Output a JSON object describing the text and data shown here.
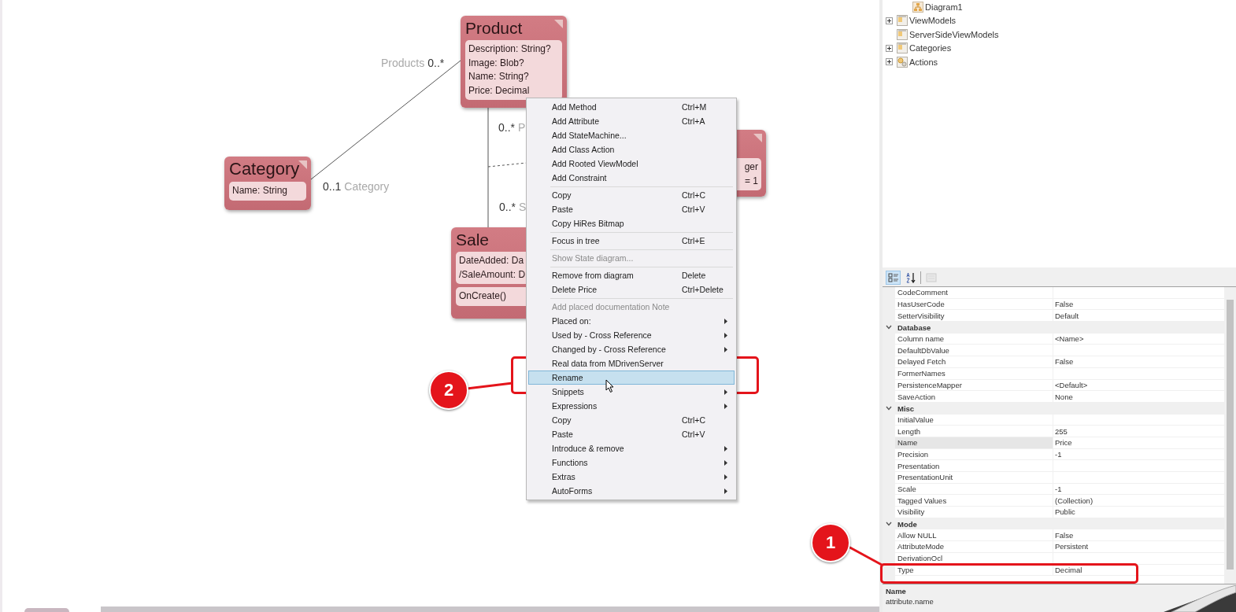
{
  "diagram": {
    "classes": [
      {
        "name": "Product",
        "attributes": [
          "Description: String?",
          "Image: Blob?",
          "Name: String?",
          "Price: Decimal"
        ]
      },
      {
        "name": "Category",
        "attributes": [
          "Name: String"
        ]
      },
      {
        "name": "Sale",
        "attributes": [
          "DateAdded: Da",
          "/SaleAmount: D"
        ],
        "methods": [
          "OnCreate()"
        ]
      },
      {
        "attributes": [
          "ger",
          "= 1"
        ]
      }
    ],
    "association_labels": [
      {
        "parts": [
          {
            "kind": "role",
            "text": "Products"
          },
          {
            "kind": "multiplicity",
            "text": "0..*"
          }
        ]
      },
      {
        "parts": [
          {
            "kind": "multiplicity",
            "text": "0..1"
          },
          {
            "kind": "role",
            "text": "Category"
          }
        ]
      },
      {
        "parts": [
          {
            "kind": "multiplicity",
            "text": "0..*"
          },
          {
            "kind": "role",
            "text": "P"
          }
        ]
      },
      {
        "parts": [
          {
            "kind": "multiplicity",
            "text": "0..*"
          },
          {
            "kind": "role",
            "text": "S"
          }
        ]
      }
    ]
  },
  "context_menu": {
    "items": [
      {
        "kind": "item",
        "label": "Add Method",
        "shortcut": "Ctrl+M",
        "submenu": false,
        "disabled": false,
        "selected": false
      },
      {
        "kind": "item",
        "label": "Add Attribute",
        "shortcut": "Ctrl+A",
        "submenu": false,
        "disabled": false,
        "selected": false
      },
      {
        "kind": "item",
        "label": "Add StateMachine...",
        "submenu": false,
        "disabled": false,
        "selected": false
      },
      {
        "kind": "item",
        "label": "Add Class Action",
        "submenu": false,
        "disabled": false,
        "selected": false
      },
      {
        "kind": "item",
        "label": "Add Rooted ViewModel",
        "submenu": false,
        "disabled": false,
        "selected": false
      },
      {
        "kind": "item",
        "label": "Add Constraint",
        "submenu": false,
        "disabled": false,
        "selected": false
      },
      {
        "kind": "separator"
      },
      {
        "kind": "item",
        "label": "Copy",
        "shortcut": "Ctrl+C",
        "submenu": false,
        "disabled": false,
        "selected": false
      },
      {
        "kind": "item",
        "label": "Paste",
        "shortcut": "Ctrl+V",
        "submenu": false,
        "disabled": false,
        "selected": false
      },
      {
        "kind": "item",
        "label": "Copy HiRes Bitmap",
        "submenu": false,
        "disabled": false,
        "selected": false
      },
      {
        "kind": "separator"
      },
      {
        "kind": "item",
        "label": "Focus in tree",
        "shortcut": "Ctrl+E",
        "submenu": false,
        "disabled": false,
        "selected": false
      },
      {
        "kind": "separator"
      },
      {
        "kind": "item",
        "label": "Show State diagram...",
        "submenu": false,
        "disabled": true,
        "selected": false
      },
      {
        "kind": "separator"
      },
      {
        "kind": "item",
        "label": "Remove from diagram",
        "shortcut": "Delete",
        "submenu": false,
        "disabled": false,
        "selected": false
      },
      {
        "kind": "item",
        "label": "Delete Price",
        "shortcut": "Ctrl+Delete",
        "submenu": false,
        "disabled": false,
        "selected": false
      },
      {
        "kind": "separator"
      },
      {
        "kind": "item",
        "label": "Add placed documentation Note",
        "submenu": false,
        "disabled": true,
        "selected": false
      },
      {
        "kind": "item",
        "label": "Placed on:",
        "submenu": true,
        "disabled": false,
        "selected": false
      },
      {
        "kind": "item",
        "label": "Used by - Cross Reference",
        "submenu": true,
        "disabled": false,
        "selected": false
      },
      {
        "kind": "item",
        "label": "Changed by - Cross Reference",
        "submenu": true,
        "disabled": false,
        "selected": false
      },
      {
        "kind": "item",
        "label": "Real data from MDrivenServer",
        "submenu": false,
        "disabled": false,
        "selected": false
      },
      {
        "kind": "item",
        "label": "Rename",
        "submenu": false,
        "disabled": false,
        "selected": true
      },
      {
        "kind": "item",
        "label": "Snippets",
        "submenu": true,
        "disabled": false,
        "selected": false
      },
      {
        "kind": "item",
        "label": "Expressions",
        "submenu": true,
        "disabled": false,
        "selected": false
      },
      {
        "kind": "item",
        "label": "Copy",
        "shortcut": "Ctrl+C",
        "submenu": false,
        "disabled": false,
        "selected": false
      },
      {
        "kind": "item",
        "label": "Paste",
        "shortcut": "Ctrl+V",
        "submenu": false,
        "disabled": false,
        "selected": false
      },
      {
        "kind": "item",
        "label": "Introduce & remove",
        "submenu": true,
        "disabled": false,
        "selected": false
      },
      {
        "kind": "item",
        "label": "Functions",
        "submenu": true,
        "disabled": false,
        "selected": false
      },
      {
        "kind": "item",
        "label": "Extras",
        "submenu": true,
        "disabled": false,
        "selected": false
      },
      {
        "kind": "item",
        "label": "AutoForms",
        "submenu": true,
        "disabled": false,
        "selected": false
      }
    ]
  },
  "tree": {
    "items": [
      {
        "kind": "diagram",
        "label": "Diagram1",
        "expandable": false
      },
      {
        "kind": "folder",
        "label": "ViewModels",
        "expandable": true
      },
      {
        "kind": "folder",
        "label": "ServerSideViewModels",
        "expandable": false
      },
      {
        "kind": "folder",
        "label": "Categories",
        "expandable": true
      },
      {
        "kind": "actions",
        "label": "Actions",
        "expandable": true
      }
    ]
  },
  "property_toolbar": [
    {
      "kind": "categorized",
      "selected": true,
      "disabled": false
    },
    {
      "kind": "alphabetical",
      "selected": false,
      "disabled": false
    },
    {
      "kind": "pages",
      "selected": false,
      "disabled": true
    }
  ],
  "properties": {
    "rows": [
      {
        "kind": "property",
        "name": "CodeComment",
        "selected": false
      },
      {
        "kind": "property",
        "name": "HasUserCode",
        "value": "False",
        "selected": false
      },
      {
        "kind": "property",
        "name": "SetterVisibility",
        "value": "Default",
        "selected": false
      },
      {
        "kind": "category",
        "label": "Database",
        "expanded": true
      },
      {
        "kind": "property",
        "name": "Column name",
        "value": "<Name>",
        "selected": false
      },
      {
        "kind": "property",
        "name": "DefaultDbValue",
        "selected": false
      },
      {
        "kind": "property",
        "name": "Delayed Fetch",
        "value": "False",
        "selected": false
      },
      {
        "kind": "property",
        "name": "FormerNames",
        "selected": false
      },
      {
        "kind": "property",
        "name": "PersistenceMapper",
        "value": "<Default>",
        "selected": false
      },
      {
        "kind": "property",
        "name": "SaveAction",
        "value": "None",
        "selected": false
      },
      {
        "kind": "category",
        "label": "Misc",
        "expanded": true
      },
      {
        "kind": "property",
        "name": "InitialValue",
        "selected": false
      },
      {
        "kind": "property",
        "name": "Length",
        "value": "255",
        "selected": false
      },
      {
        "kind": "property",
        "name": "Name",
        "value": "Price",
        "selected": true
      },
      {
        "kind": "property",
        "name": "Precision",
        "value": "-1",
        "selected": false
      },
      {
        "kind": "property",
        "name": "Presentation",
        "selected": false
      },
      {
        "kind": "property",
        "name": "PresentationUnit",
        "selected": false
      },
      {
        "kind": "property",
        "name": "Scale",
        "value": "-1",
        "selected": false
      },
      {
        "kind": "property",
        "name": "Tagged Values",
        "value": "(Collection)",
        "selected": false
      },
      {
        "kind": "property",
        "name": "Visibility",
        "value": "Public",
        "selected": false
      },
      {
        "kind": "category",
        "label": "Mode",
        "expanded": true
      },
      {
        "kind": "property",
        "name": "Allow NULL",
        "value": "False",
        "selected": false
      },
      {
        "kind": "property",
        "name": "AttributeMode",
        "value": "Persistent",
        "selected": false
      },
      {
        "kind": "property",
        "name": "DerivationOcl",
        "selected": false
      },
      {
        "kind": "property",
        "name": "Type",
        "value": "Decimal",
        "selected": false
      }
    ]
  },
  "description": {
    "title": "Name",
    "text": "attribute.name"
  },
  "callouts": [
    {
      "number": "2"
    },
    {
      "number": "1"
    }
  ]
}
